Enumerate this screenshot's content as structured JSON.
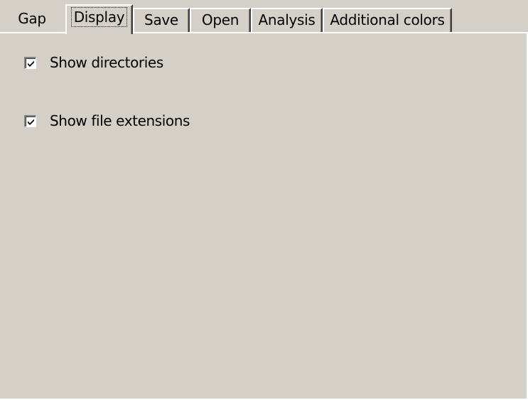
{
  "tabs": [
    {
      "label": "Gap",
      "selected": false
    },
    {
      "label": "Display",
      "selected": true
    },
    {
      "label": "Save",
      "selected": false
    },
    {
      "label": "Open",
      "selected": false
    },
    {
      "label": "Analysis",
      "selected": false
    },
    {
      "label": "Additional colors",
      "selected": false
    }
  ],
  "display_page": {
    "show_directories": {
      "label": "Show directories",
      "checked": true
    },
    "show_file_extensions": {
      "label": "Show file extensions",
      "checked": true
    }
  },
  "colors": {
    "face": "#d4d0c8",
    "highlight": "#ffffff",
    "shadow": "#808080",
    "dark_shadow": "#404040"
  },
  "icons": {
    "checkmark": "checkmark-icon"
  }
}
